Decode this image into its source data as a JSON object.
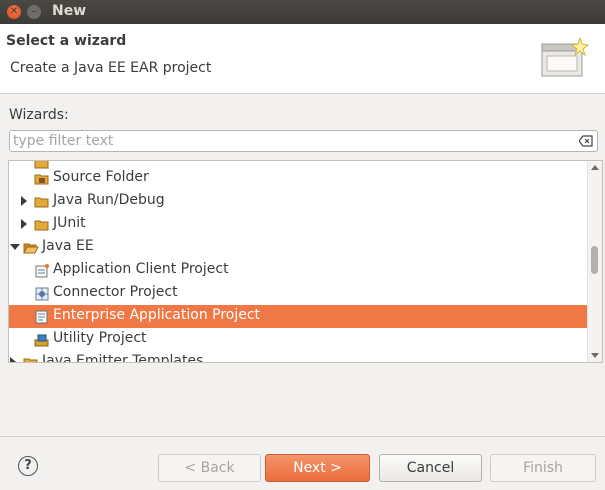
{
  "window": {
    "title": "New"
  },
  "header": {
    "title": "Select a wizard",
    "description": "Create a Java EE EAR project",
    "icon": "wizard-banner-icon"
  },
  "wizards_label": "Wizards:",
  "filter": {
    "placeholder": "type filter text",
    "value": "",
    "clear_icon": "clear-filter-icon"
  },
  "tree": {
    "items": [
      {
        "label": "Source Folder",
        "icon": "source-folder-icon"
      },
      {
        "label": "Java Run/Debug",
        "icon": "folder-icon",
        "expander": "collapsed"
      },
      {
        "label": "JUnit",
        "icon": "folder-icon",
        "expander": "collapsed"
      },
      {
        "label": "Java EE",
        "icon": "folder-open-icon",
        "expander": "expanded"
      },
      {
        "label": "Application Client Project",
        "icon": "app-client-project-icon"
      },
      {
        "label": "Connector Project",
        "icon": "connector-project-icon"
      },
      {
        "label": "Enterprise Application Project",
        "icon": "ear-project-icon",
        "selected": true
      },
      {
        "label": "Utility Project",
        "icon": "utility-project-icon"
      },
      {
        "label": "Java Emitter Templates",
        "icon": "folder-icon",
        "expander": "collapsed"
      }
    ]
  },
  "buttons": {
    "help": "?",
    "back": "< Back",
    "next": "Next >",
    "cancel": "Cancel",
    "finish": "Finish"
  },
  "colors": {
    "accent": "#f07746",
    "titlebar": "#3c3b37",
    "window_bg": "#f2f1f0"
  }
}
